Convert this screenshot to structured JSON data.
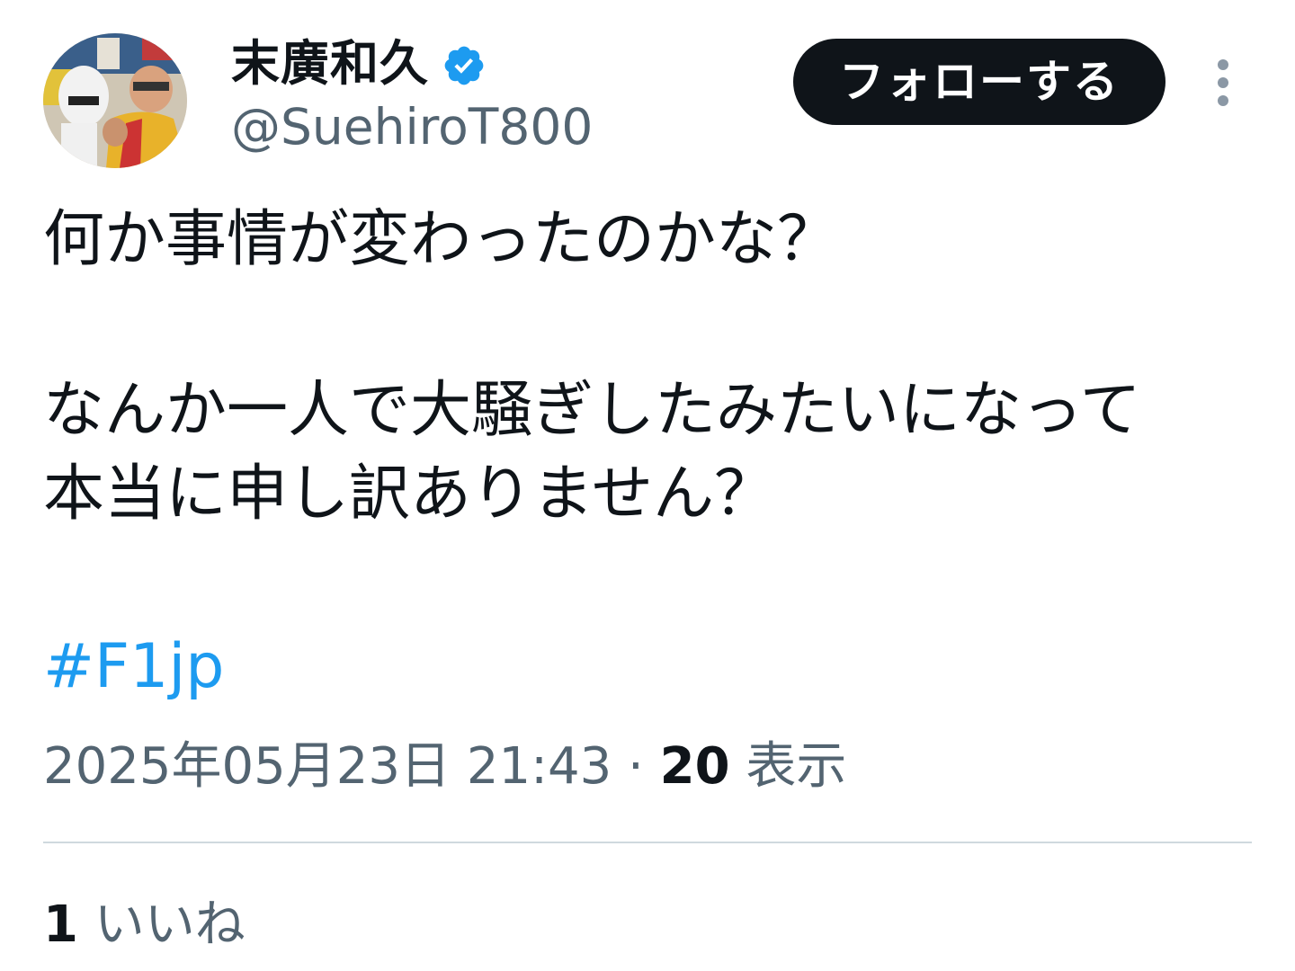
{
  "user": {
    "display_name": "末廣和久",
    "handle": "@SuehiroT800",
    "verified": true,
    "verified_badge_color": "#1d9bf0"
  },
  "follow_button": {
    "label": "フォローする"
  },
  "more_menu": {
    "icon": "more-vertical-icon"
  },
  "tweet": {
    "lines": [
      "何か事情が変わったのかな？",
      "なんか一人で大騒ぎしたみたいになって",
      "本当に申し訳ありません？"
    ],
    "hashtag": "#F1jp",
    "hashtag_color": "#1d9bf0",
    "timestamp": "2025年05月23日 21:43",
    "separator": "·",
    "views_count": "20",
    "views_label": "表示"
  },
  "engagement": {
    "likes_count": "1",
    "likes_label": "いいね"
  },
  "colors": {
    "text_primary": "#0f1419",
    "text_secondary": "#536471",
    "divider": "#cfd9de"
  }
}
